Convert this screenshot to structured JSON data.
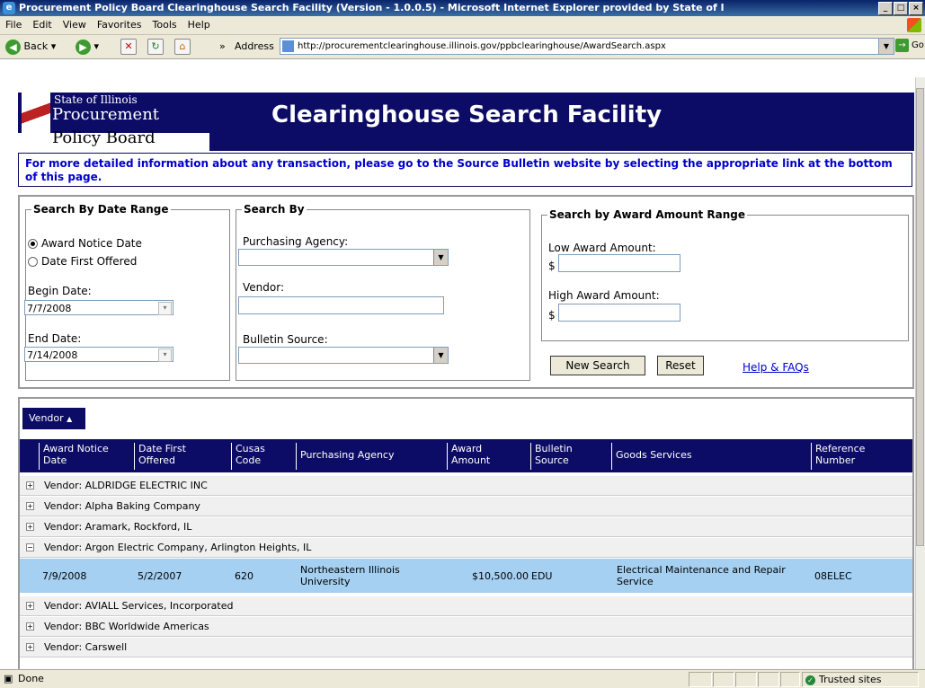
{
  "window": {
    "title": "Procurement Policy Board Clearinghouse Search Facility (Version - 1.0.0.5) - Microsoft Internet Explorer provided by State of I"
  },
  "menu": [
    "File",
    "Edit",
    "View",
    "Favorites",
    "Tools",
    "Help"
  ],
  "toolbar": {
    "back_label": "Back",
    "address_label": "Address",
    "url": "http://procurementclearinghouse.illinois.gov/ppbclearinghouse/AwardSearch.aspx",
    "go_label": "Go"
  },
  "header": {
    "state_label": "State of Illinois",
    "logo_line1": "Procurement",
    "logo_line2": "Policy Board",
    "title": "Clearinghouse Search Facility",
    "info_text": "For more detailed information about any transaction, please go to the Source Bulletin website by selecting the appropriate link at the bottom of this page."
  },
  "date_range": {
    "legend": "Search By Date Range",
    "option_award": "Award Notice Date",
    "option_first": "Date First Offered",
    "selected": "award",
    "begin_label": "Begin Date:",
    "begin_value": "7/7/2008",
    "end_label": "End Date:",
    "end_value": "7/14/2008"
  },
  "search_by": {
    "legend": "Search By",
    "agency_label": "Purchasing Agency:",
    "agency_value": "",
    "vendor_label": "Vendor:",
    "vendor_value": "",
    "bulletin_label": "Bulletin Source:",
    "bulletin_value": ""
  },
  "amount_range": {
    "legend": "Search by Award Amount Range",
    "low_label": "Low Award Amount:",
    "high_label": "High Award Amount:",
    "currency": "$",
    "low_value": "",
    "high_value": ""
  },
  "actions": {
    "new_search": "New Search",
    "reset": "Reset",
    "help": "Help & FAQs"
  },
  "grid": {
    "group_button": "Vendor",
    "columns": [
      [
        "Award Notice",
        "Date"
      ],
      [
        "Date First",
        "Offered"
      ],
      [
        "Cusas",
        "Code"
      ],
      [
        "Purchasing Agency",
        ""
      ],
      [
        "Award",
        "Amount"
      ],
      [
        "Bulletin",
        "Source"
      ],
      [
        "Goods Services",
        ""
      ],
      [
        "Reference",
        "Number"
      ]
    ],
    "groups": [
      {
        "label": "Vendor: ALDRIDGE ELECTRIC INC",
        "expanded": false
      },
      {
        "label": "Vendor: Alpha Baking Company",
        "expanded": false
      },
      {
        "label": "Vendor: Aramark, Rockford, IL",
        "expanded": false
      },
      {
        "label": "Vendor: Argon Electric Company, Arlington Heights, IL",
        "expanded": true
      },
      {
        "label": "Vendor: AVIALL Services, Incorporated",
        "expanded": false
      },
      {
        "label": "Vendor: BBC Worldwide Americas",
        "expanded": false
      },
      {
        "label": "Vendor: Carswell",
        "expanded": false
      }
    ],
    "detail_row": {
      "award_date": "7/9/2008",
      "first_offered": "5/2/2007",
      "cusas": "620",
      "agency": "Northeastern Illinois University",
      "amount": "$10,500.00",
      "bulletin": "EDU",
      "goods": "Electrical Maintenance and Repair Service",
      "reference": "08ELEC"
    }
  },
  "status_bar": {
    "text": "Done",
    "zone": "Trusted sites"
  },
  "colors": {
    "banner": "#0c0c66",
    "info_text": "#0000cc",
    "selected_row": "#a5d0f2"
  }
}
